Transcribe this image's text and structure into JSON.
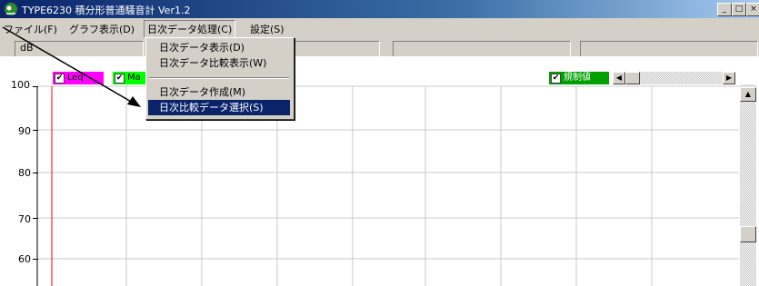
{
  "window": {
    "title": "TYPE6230 積分形普通騒音計 Ver1.2",
    "minimize_label": "_",
    "maximize_label": "□",
    "close_label": "×"
  },
  "menubar": {
    "items": [
      {
        "label": "ファイル(F)"
      },
      {
        "label": "グラフ表示(D)"
      },
      {
        "label": "日次データ処理(C)"
      },
      {
        "label": "設定(S)"
      }
    ]
  },
  "dropdown": {
    "items": [
      {
        "label": "日次データ表示(D)"
      },
      {
        "label": "日次データ比較表示(W)"
      },
      {
        "label": "日次データ作成(M)"
      },
      {
        "label": "日次比較データ選択(S)"
      }
    ],
    "selected_index": 3
  },
  "legend": {
    "leq_label": "Leq",
    "max_label": "Ma",
    "regulation_label": "規制値",
    "leq_color": "#ff00ff",
    "max_color": "#00ff00",
    "regulation_color": "#00a000"
  },
  "chart_data": {
    "type": "line",
    "ylabel": "dB",
    "y_ticks": [
      "100",
      "90",
      "80",
      "70",
      "60"
    ],
    "ylim": [
      55,
      100
    ],
    "grid": true,
    "series": []
  }
}
